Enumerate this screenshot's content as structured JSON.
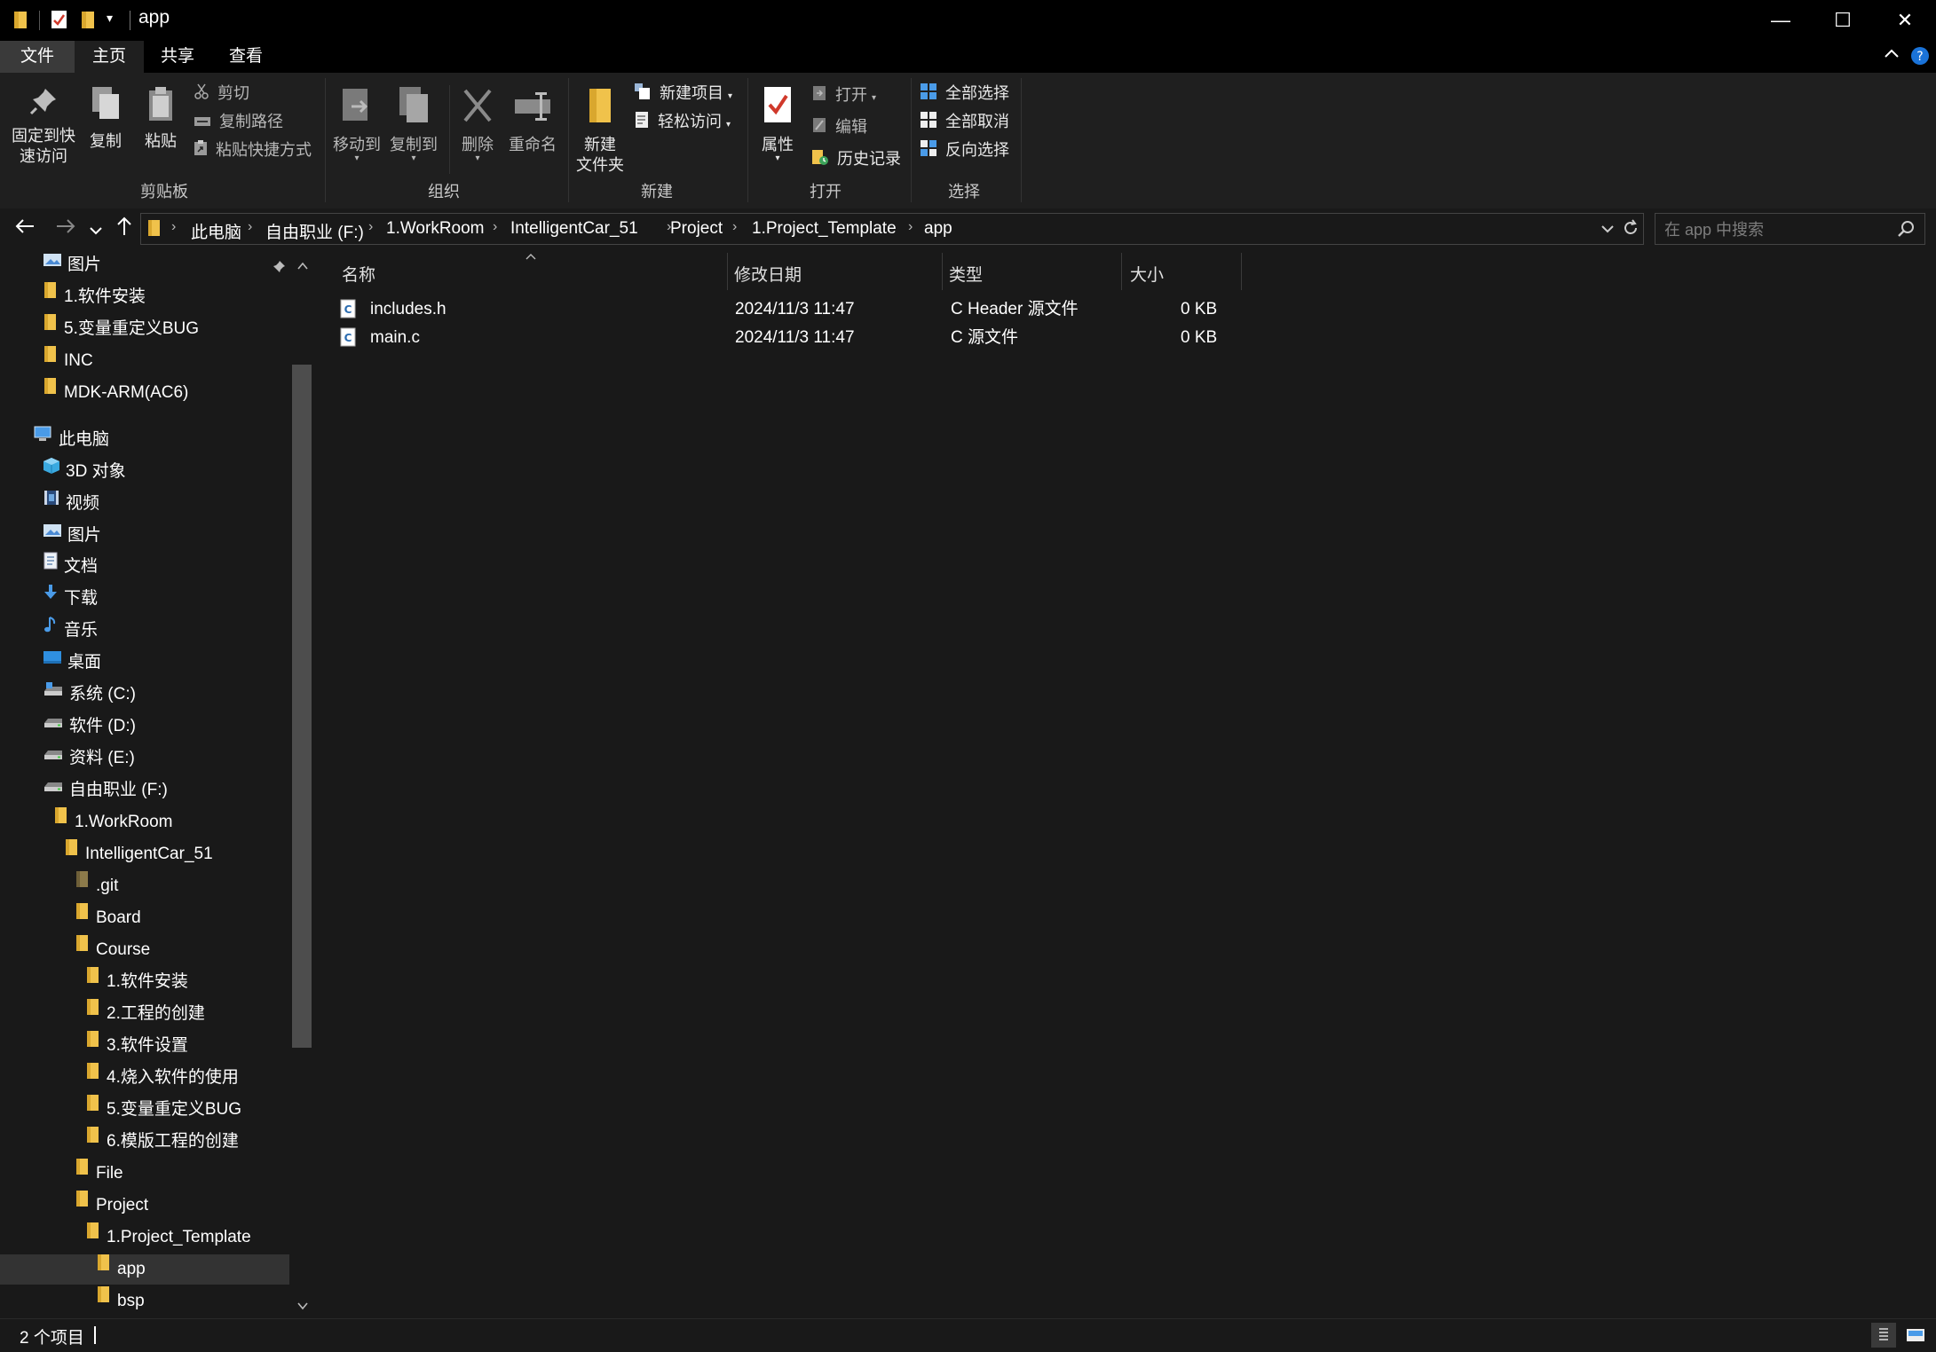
{
  "window": {
    "title": "app",
    "controls": {
      "minimize": "—",
      "maximize": "☐",
      "close": "✕"
    }
  },
  "menu_tabs": [
    "文件",
    "主页",
    "共享",
    "查看"
  ],
  "ribbon": {
    "clipboard": {
      "pin_line1": "固定到快",
      "pin_line2": "速访问",
      "copy": "复制",
      "paste": "粘贴",
      "cut": "剪切",
      "copy_path": "复制路径",
      "paste_shortcut": "粘贴快捷方式",
      "label": "剪贴板"
    },
    "organize": {
      "move_to": "移动到",
      "copy_to": "复制到",
      "delete": "删除",
      "rename": "重命名",
      "label": "组织"
    },
    "new": {
      "new_item": "新建项目",
      "easy_access": "轻松访问",
      "new_folder_line1": "新建",
      "new_folder_line2": "文件夹",
      "label": "新建"
    },
    "open": {
      "properties": "属性",
      "open": "打开",
      "edit": "编辑",
      "history": "历史记录",
      "label": "打开"
    },
    "select": {
      "select_all": "全部选择",
      "select_none": "全部取消",
      "invert": "反向选择",
      "label": "选择"
    }
  },
  "address": {
    "crumbs": [
      "此电脑",
      "自由职业 (F:)",
      "1.WorkRoom",
      "IntelligentCar_51",
      "Project",
      "1.Project_Template",
      "app"
    ],
    "search_placeholder": "在 app 中搜索"
  },
  "nav_tree": [
    {
      "label": "图片",
      "icon": "pictures-icon"
    },
    {
      "label": "1.软件安装",
      "icon": "folder-icon"
    },
    {
      "label": "5.变量重定义BUG",
      "icon": "folder-icon"
    },
    {
      "label": "INC",
      "icon": "folder-icon"
    },
    {
      "label": "MDK-ARM(AC6)",
      "icon": "folder-icon"
    },
    {
      "label": "此电脑",
      "icon": "computer-icon"
    },
    {
      "label": "3D 对象",
      "icon": "3d-objects-icon"
    },
    {
      "label": "视频",
      "icon": "video-icon"
    },
    {
      "label": "图片",
      "icon": "pictures-icon"
    },
    {
      "label": "文档",
      "icon": "documents-icon"
    },
    {
      "label": "下载",
      "icon": "download-icon"
    },
    {
      "label": "音乐",
      "icon": "music-icon"
    },
    {
      "label": "桌面",
      "icon": "desktop-icon"
    },
    {
      "label": "系统 (C:)",
      "icon": "system-drive-icon"
    },
    {
      "label": "软件 (D:)",
      "icon": "drive-icon"
    },
    {
      "label": "资料 (E:)",
      "icon": "drive-icon"
    },
    {
      "label": "自由职业 (F:)",
      "icon": "drive-icon"
    },
    {
      "label": "1.WorkRoom",
      "icon": "folder-icon"
    },
    {
      "label": "IntelligentCar_51",
      "icon": "folder-icon"
    },
    {
      "label": ".git",
      "icon": "hidden-folder-icon"
    },
    {
      "label": "Board",
      "icon": "folder-icon"
    },
    {
      "label": "Course",
      "icon": "folder-icon"
    },
    {
      "label": "1.软件安装",
      "icon": "folder-icon"
    },
    {
      "label": "2.工程的创建",
      "icon": "folder-icon"
    },
    {
      "label": "3.软件设置",
      "icon": "folder-icon"
    },
    {
      "label": "4.烧入软件的使用",
      "icon": "folder-icon"
    },
    {
      "label": "5.变量重定义BUG",
      "icon": "folder-icon"
    },
    {
      "label": "6.模版工程的创建",
      "icon": "folder-icon"
    },
    {
      "label": "File",
      "icon": "folder-icon"
    },
    {
      "label": "Project",
      "icon": "folder-icon"
    },
    {
      "label": "1.Project_Template",
      "icon": "folder-icon"
    },
    {
      "label": "app",
      "icon": "folder-icon",
      "selected": true
    },
    {
      "label": "bsp",
      "icon": "folder-icon"
    }
  ],
  "file_list": {
    "columns": [
      "名称",
      "修改日期",
      "类型",
      "大小"
    ],
    "rows": [
      {
        "name": "includes.h",
        "date": "2024/11/3 11:47",
        "type": "C Header 源文件",
        "size": "0 KB",
        "icon": "c-file-icon"
      },
      {
        "name": "main.c",
        "date": "2024/11/3 11:47",
        "type": "C 源文件",
        "size": "0 KB",
        "icon": "c-file-icon"
      }
    ]
  },
  "status": {
    "item_count": "2 个项目"
  },
  "colors": {
    "accent": "#0078d7",
    "folder": "#f0c24b",
    "background": "#191919",
    "titlebar": "#000000"
  }
}
